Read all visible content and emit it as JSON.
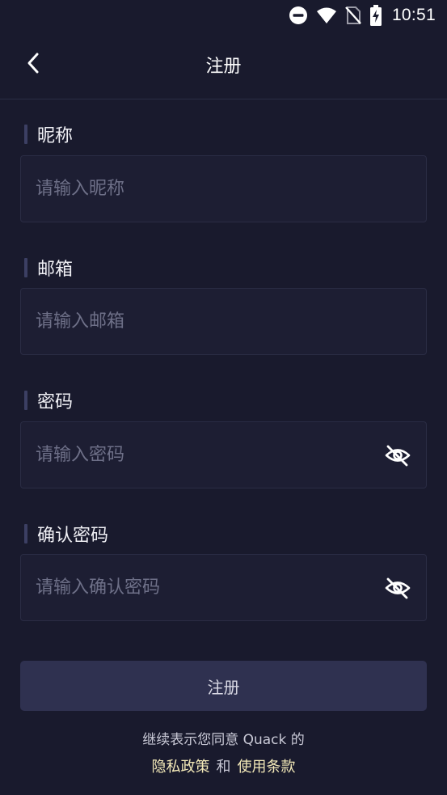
{
  "status_bar": {
    "time": "10:51",
    "icons": [
      "do-not-disturb-icon",
      "wifi-icon",
      "no-sim-icon",
      "battery-charging-icon"
    ]
  },
  "header": {
    "back_icon": "chevron-left-icon",
    "title": "注册"
  },
  "form": {
    "nickname": {
      "label": "昵称",
      "placeholder": "请输入昵称"
    },
    "email": {
      "label": "邮箱",
      "placeholder": "请输入邮箱"
    },
    "password": {
      "label": "密码",
      "placeholder": "请输入密码",
      "toggle_icon": "eye-off-icon"
    },
    "confirm_password": {
      "label": "确认密码",
      "placeholder": "请输入确认密码",
      "toggle_icon": "eye-off-icon"
    }
  },
  "submit": {
    "label": "注册"
  },
  "agreement": {
    "text": "继续表示您同意 Quack 的",
    "privacy_link": "隐私政策",
    "conjunction": "和",
    "terms_link": "使用条款"
  },
  "colors": {
    "background": "#191a2d",
    "input_bg": "#1d1e33",
    "button_bg": "#2f3150",
    "link": "#f3e9b8",
    "label_bar": "#3c3f63"
  }
}
